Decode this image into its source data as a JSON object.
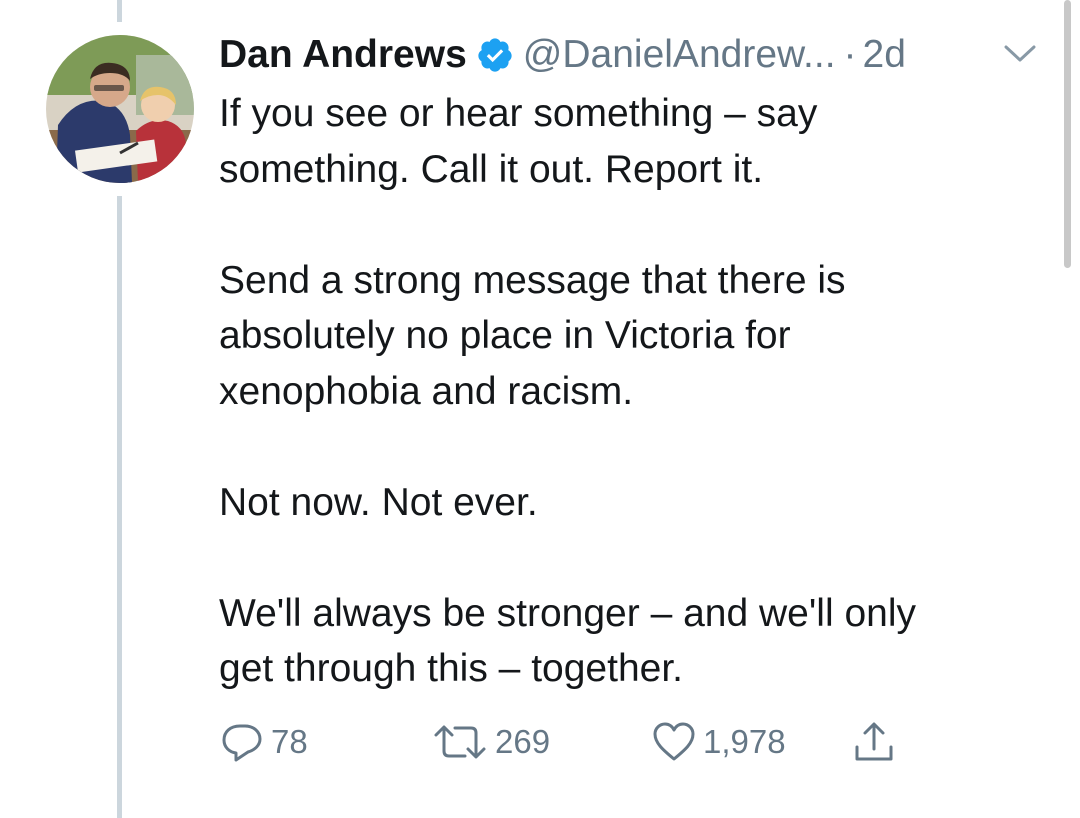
{
  "tweet": {
    "author_name": "Dan Andrews",
    "verified": true,
    "handle": "@DanielAndrew...",
    "separator": "·",
    "time_ago": "2d",
    "paragraphs": [
      "If you see or hear something – say\nsomething. Call it out. Report it.",
      "Send a strong message that there is\nabsolutely no place in Victoria for\nxenophobia and racism.",
      "Not now. Not ever.",
      "We'll always be stronger – and we'll only\nget through this – together."
    ],
    "actions": {
      "reply": {
        "icon": "reply-icon",
        "count": "78"
      },
      "retweet": {
        "icon": "retweet-icon",
        "count": "269"
      },
      "like": {
        "icon": "heart-icon",
        "count": "1,978"
      },
      "share": {
        "icon": "share-icon"
      }
    }
  },
  "colors": {
    "text": "#14171a",
    "secondary": "#657786",
    "verified_badge": "#1da1f2",
    "thread_line": "#ccd6dd"
  }
}
